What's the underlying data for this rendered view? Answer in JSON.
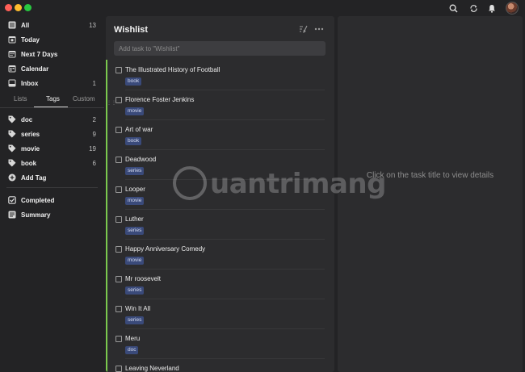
{
  "sidebar": {
    "smart_lists": [
      {
        "label": "All",
        "count": "13",
        "icon": "all-icon"
      },
      {
        "label": "Today",
        "count": "",
        "icon": "today-icon"
      },
      {
        "label": "Next 7 Days",
        "count": "",
        "icon": "next7-icon"
      },
      {
        "label": "Calendar",
        "count": "",
        "icon": "calendar-icon"
      },
      {
        "label": "Inbox",
        "count": "1",
        "icon": "inbox-icon"
      }
    ],
    "tabs": [
      "Lists",
      "Tags",
      "Custom"
    ],
    "active_tab": "Tags",
    "tags": [
      {
        "label": "doc",
        "count": "2"
      },
      {
        "label": "series",
        "count": "9"
      },
      {
        "label": "movie",
        "count": "19"
      },
      {
        "label": "book",
        "count": "6"
      }
    ],
    "add_tag_label": "Add Tag",
    "completed_label": "Completed",
    "summary_label": "Summary"
  },
  "list": {
    "title": "Wishlist",
    "add_placeholder": "Add task to \"Wishlist\"",
    "tasks": [
      {
        "title": "The Illustrated History of Football",
        "tag": "book"
      },
      {
        "title": "Florence Foster Jenkins",
        "tag": "movie"
      },
      {
        "title": "Art of war",
        "tag": "book"
      },
      {
        "title": "Deadwood",
        "tag": "series"
      },
      {
        "title": "Looper",
        "tag": "movie"
      },
      {
        "title": "Luther",
        "tag": "series"
      },
      {
        "title": "Happy Anniversary Comedy",
        "tag": "movie"
      },
      {
        "title": "Mr roosevelt",
        "tag": "series"
      },
      {
        "title": "Win It All",
        "tag": "series"
      },
      {
        "title": "Meru",
        "tag": "doc"
      },
      {
        "title": "Leaving Neverland",
        "tag": ""
      }
    ]
  },
  "detail": {
    "hint": "Click on the task title to view details"
  },
  "watermark": {
    "text": "uantrimang"
  },
  "colors": {
    "accent": "#7bc94e",
    "tag_bg": "#3a4a7a"
  }
}
